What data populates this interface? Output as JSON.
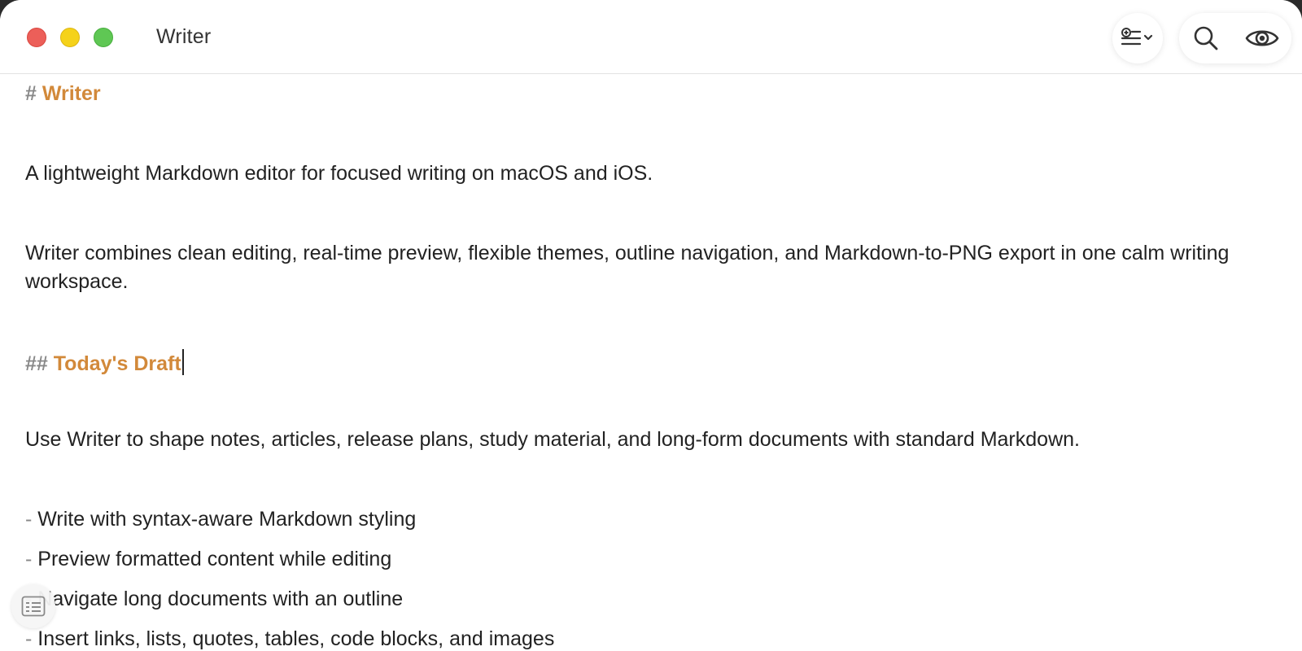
{
  "window": {
    "title": "Writer"
  },
  "toolbar": {
    "format_icon": "format-list-icon",
    "search_icon": "search-icon",
    "preview_icon": "eye-icon"
  },
  "document": {
    "h1_mark": "#",
    "h1_text": "Writer",
    "para1": "A lightweight Markdown editor for focused writing on macOS and iOS.",
    "para2": "Writer combines clean editing, real-time preview, flexible themes, outline navigation, and Markdown-to-PNG export in one calm writing workspace.",
    "h2_mark": "##",
    "h2_text": "Today's Draft",
    "para3": "Use Writer to shape notes, articles, release plans, study material, and long-form documents with standard Markdown.",
    "list": [
      {
        "mark": "-",
        "text": "Write with syntax-aware Markdown styling"
      },
      {
        "mark": "-",
        "text": "Preview formatted content while editing"
      },
      {
        "mark": "-",
        "text": "Navigate long documents with an outline"
      },
      {
        "mark": "-",
        "text": "Insert links, lists, quotes, tables, code blocks, and images"
      }
    ]
  },
  "colors": {
    "heading_accent": "#d2893a",
    "close": "#ec5f59",
    "minimize": "#f5d21a",
    "maximize": "#5fc754"
  }
}
